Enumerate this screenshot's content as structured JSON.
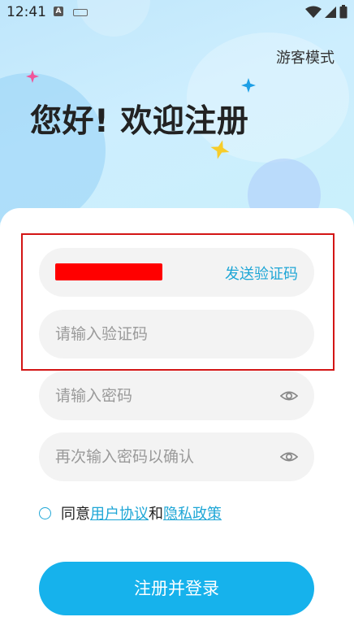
{
  "status_bar": {
    "time": "12:41",
    "notification_letter": "A"
  },
  "header": {
    "guest_mode": "游客模式",
    "title": "您好! 欢迎注册"
  },
  "form": {
    "send_code": "发送验证码",
    "code_placeholder": "请输入验证码",
    "password_placeholder": "请输入密码",
    "confirm_placeholder": "再次输入密码以确认"
  },
  "agreement": {
    "prefix": "同意",
    "user_agreement": "用户协议",
    "and": "和",
    "privacy_policy": "隐私政策"
  },
  "submit_label": "注册并登录",
  "colors": {
    "accent": "#1ea6d6",
    "button": "#16b2ec",
    "annotation_box": "#d31515",
    "redaction": "#ff0000"
  }
}
